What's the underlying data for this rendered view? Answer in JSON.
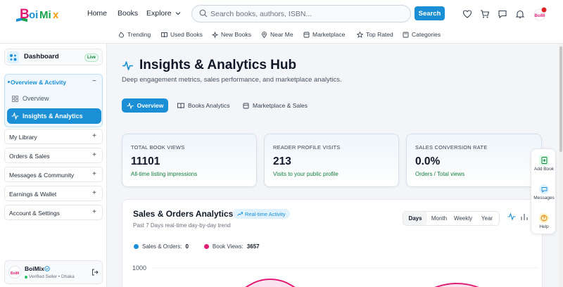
{
  "brand": {
    "name": "BoiMix",
    "accent": "#1a8fd6"
  },
  "topnav": {
    "home": "Home",
    "books": "Books",
    "explore": "Explore"
  },
  "search": {
    "placeholder": "Search books, authors, ISBN...",
    "button": "Search"
  },
  "header_icons": [
    "heart-icon",
    "cart-icon",
    "chat-icon",
    "bell-icon",
    "avatar"
  ],
  "subnav": [
    "Trending",
    "Used Books",
    "New Books",
    "Near Me",
    "Marketplace",
    "Top Rated",
    "Categories"
  ],
  "sidebar": {
    "dashboard": "Dashboard",
    "live": "Live",
    "open_section": "Overview & Activity",
    "sub_items": [
      "Overview",
      "Insights & Analytics"
    ],
    "sections": [
      "My Library",
      "Orders & Sales",
      "Messages & Community",
      "Earnings & Wallet",
      "Account & Settings"
    ],
    "profile": {
      "name": "BoiMix",
      "subtitle": "Verified Seller • Dhaka"
    }
  },
  "page": {
    "title": "Insights & Analytics Hub",
    "subtitle": "Deep engagement metrics, sales performance, and marketplace analytics.",
    "tabs": [
      "Overview",
      "Books Analytics",
      "Marketplace & Sales"
    ]
  },
  "cards": [
    {
      "label": "TOTAL BOOK VIEWS",
      "value": "11101",
      "desc": "All-time listing impressions"
    },
    {
      "label": "READER PROFILE VISITS",
      "value": "213",
      "desc": "Visits to your public profile"
    },
    {
      "label": "SALES CONVERSION RATE",
      "value": "0.0%",
      "desc": "Orders / Total views"
    }
  ],
  "analytics": {
    "title": "Sales & Orders Analytics",
    "badge": "Real-time Activity",
    "subtitle": "Past 7 Days real-time day-by-day trend",
    "ranges": [
      "Days",
      "Month",
      "Weekly",
      "Year"
    ],
    "legend": [
      {
        "name": "Sales & Orders:",
        "value": "0",
        "color": "#1a8fd6"
      },
      {
        "name": "Book Views:",
        "value": "3657",
        "color": "#e11d74"
      }
    ],
    "y_tick": "1000"
  },
  "dock": [
    "Add Book",
    "Messages",
    "Help"
  ]
}
